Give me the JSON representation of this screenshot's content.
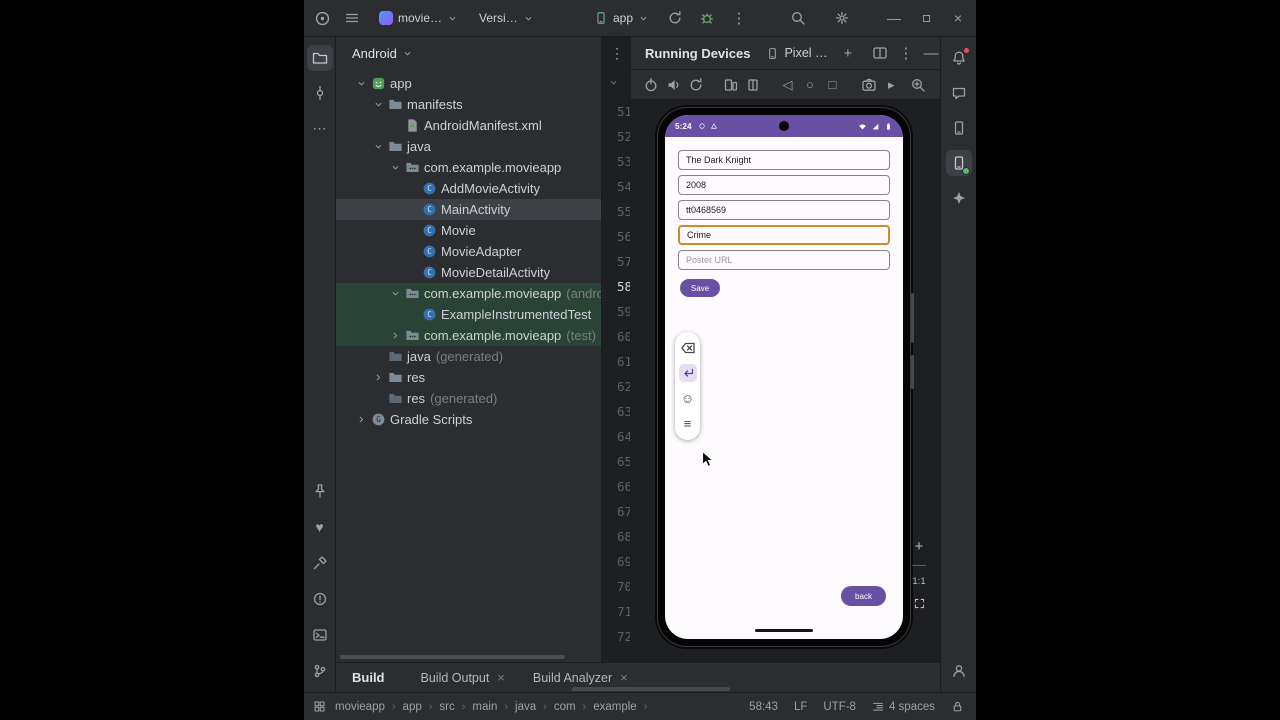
{
  "colors": {
    "accent_purple": "#6850a4",
    "focus_border_orange": "#cf8a2c",
    "vcs_added_row_green": "#294436",
    "selected_row_gray": "#3d4045",
    "panel_bg": "#2b2d30",
    "editor_bg": "#1e1f22"
  },
  "titlebar": {
    "project": "movie…",
    "vcs": "Versi…",
    "run_target": "app"
  },
  "left_dock": {
    "top": [
      "project",
      "commit",
      "more-h"
    ],
    "bottom": [
      "pin",
      "favorites",
      "build",
      "problems",
      "terminal",
      "version-control"
    ]
  },
  "right_dock": {
    "top": [
      "notifications",
      "ai-assistant",
      "device-manager",
      "running-devices",
      "gemini"
    ],
    "bottom": [
      "profile"
    ]
  },
  "project_panel": {
    "view": "Android",
    "tree": [
      {
        "label": "app",
        "icon": "android-module",
        "indent": 0,
        "chevron": "open"
      },
      {
        "label": "manifests",
        "icon": "folder",
        "indent": 1,
        "chevron": "open"
      },
      {
        "label": "AndroidManifest.xml",
        "icon": "manifest-file",
        "indent": 2
      },
      {
        "label": "java",
        "icon": "folder",
        "indent": 1,
        "chevron": "open"
      },
      {
        "label": "com.example.movieapp",
        "icon": "package",
        "indent": 2,
        "chevron": "open"
      },
      {
        "label": "AddMovieActivity",
        "icon": "class",
        "indent": 3
      },
      {
        "label": "MainActivity",
        "icon": "class",
        "indent": 3,
        "selected": true
      },
      {
        "label": "Movie",
        "icon": "class",
        "indent": 3
      },
      {
        "label": "MovieAdapter",
        "icon": "class",
        "indent": 3
      },
      {
        "label": "MovieDetailActivity",
        "icon": "class",
        "indent": 3
      },
      {
        "label": "com.example.movieapp",
        "suffix": "(androidTest)",
        "icon": "package",
        "indent": 2,
        "chevron": "open",
        "vcs": true
      },
      {
        "label": "ExampleInstrumentedTest",
        "icon": "class",
        "indent": 3,
        "vcs": true
      },
      {
        "label": "com.example.movieapp",
        "suffix": "(test)",
        "icon": "package",
        "indent": 2,
        "chevron": "closed",
        "vcs": true
      },
      {
        "label": "java",
        "suffix": "(generated)",
        "icon": "folder-gen",
        "indent": 1
      },
      {
        "label": "res",
        "icon": "folder",
        "indent": 1,
        "chevron": "closed"
      },
      {
        "label": "res",
        "suffix": "(generated)",
        "icon": "folder-gen",
        "indent": 1
      },
      {
        "label": "Gradle Scripts",
        "icon": "gradle",
        "indent": 0,
        "chevron": "closed"
      }
    ]
  },
  "editor": {
    "gutter_lines": [
      "51",
      "52",
      "53",
      "54",
      "55",
      "56",
      "57",
      "58",
      "59",
      "60",
      "61",
      "62",
      "63",
      "64",
      "65",
      "66",
      "67",
      "68",
      "69",
      "70",
      "71",
      "72"
    ],
    "current_line": "58"
  },
  "running_devices": {
    "title": "Running Devices",
    "device_tab": "Pixel …",
    "zoom": "1:1",
    "toolbar": [
      "power",
      "volume",
      "rotate",
      "fold-open",
      "fold-closed",
      "back-nav",
      "home-nav",
      "recents-nav",
      "screenshot",
      "expand",
      "zoom-mode"
    ]
  },
  "phone": {
    "time": "5:24",
    "fields": [
      {
        "name": "title",
        "value": "The Dark Knight"
      },
      {
        "name": "year",
        "value": "2008"
      },
      {
        "name": "imdb-id",
        "value": "tt0468569"
      },
      {
        "name": "genre",
        "value": "Crime",
        "focused": true
      },
      {
        "name": "poster-url",
        "placeholder": "Poster URL"
      }
    ],
    "save": "Save",
    "back": "back",
    "ime_bar": [
      "backspace",
      "enter",
      "emoji",
      "keyboard-menu"
    ]
  },
  "build_panel": {
    "title": "Build",
    "tabs": [
      "Build Output",
      "Build Analyzer"
    ]
  },
  "status_bar": {
    "breadcrumbs": [
      "movieapp",
      "app",
      "src",
      "main",
      "java",
      "com",
      "example"
    ],
    "caret_position": "58:43",
    "line_ending": "LF",
    "encoding": "UTF-8",
    "indent": "4 spaces"
  }
}
